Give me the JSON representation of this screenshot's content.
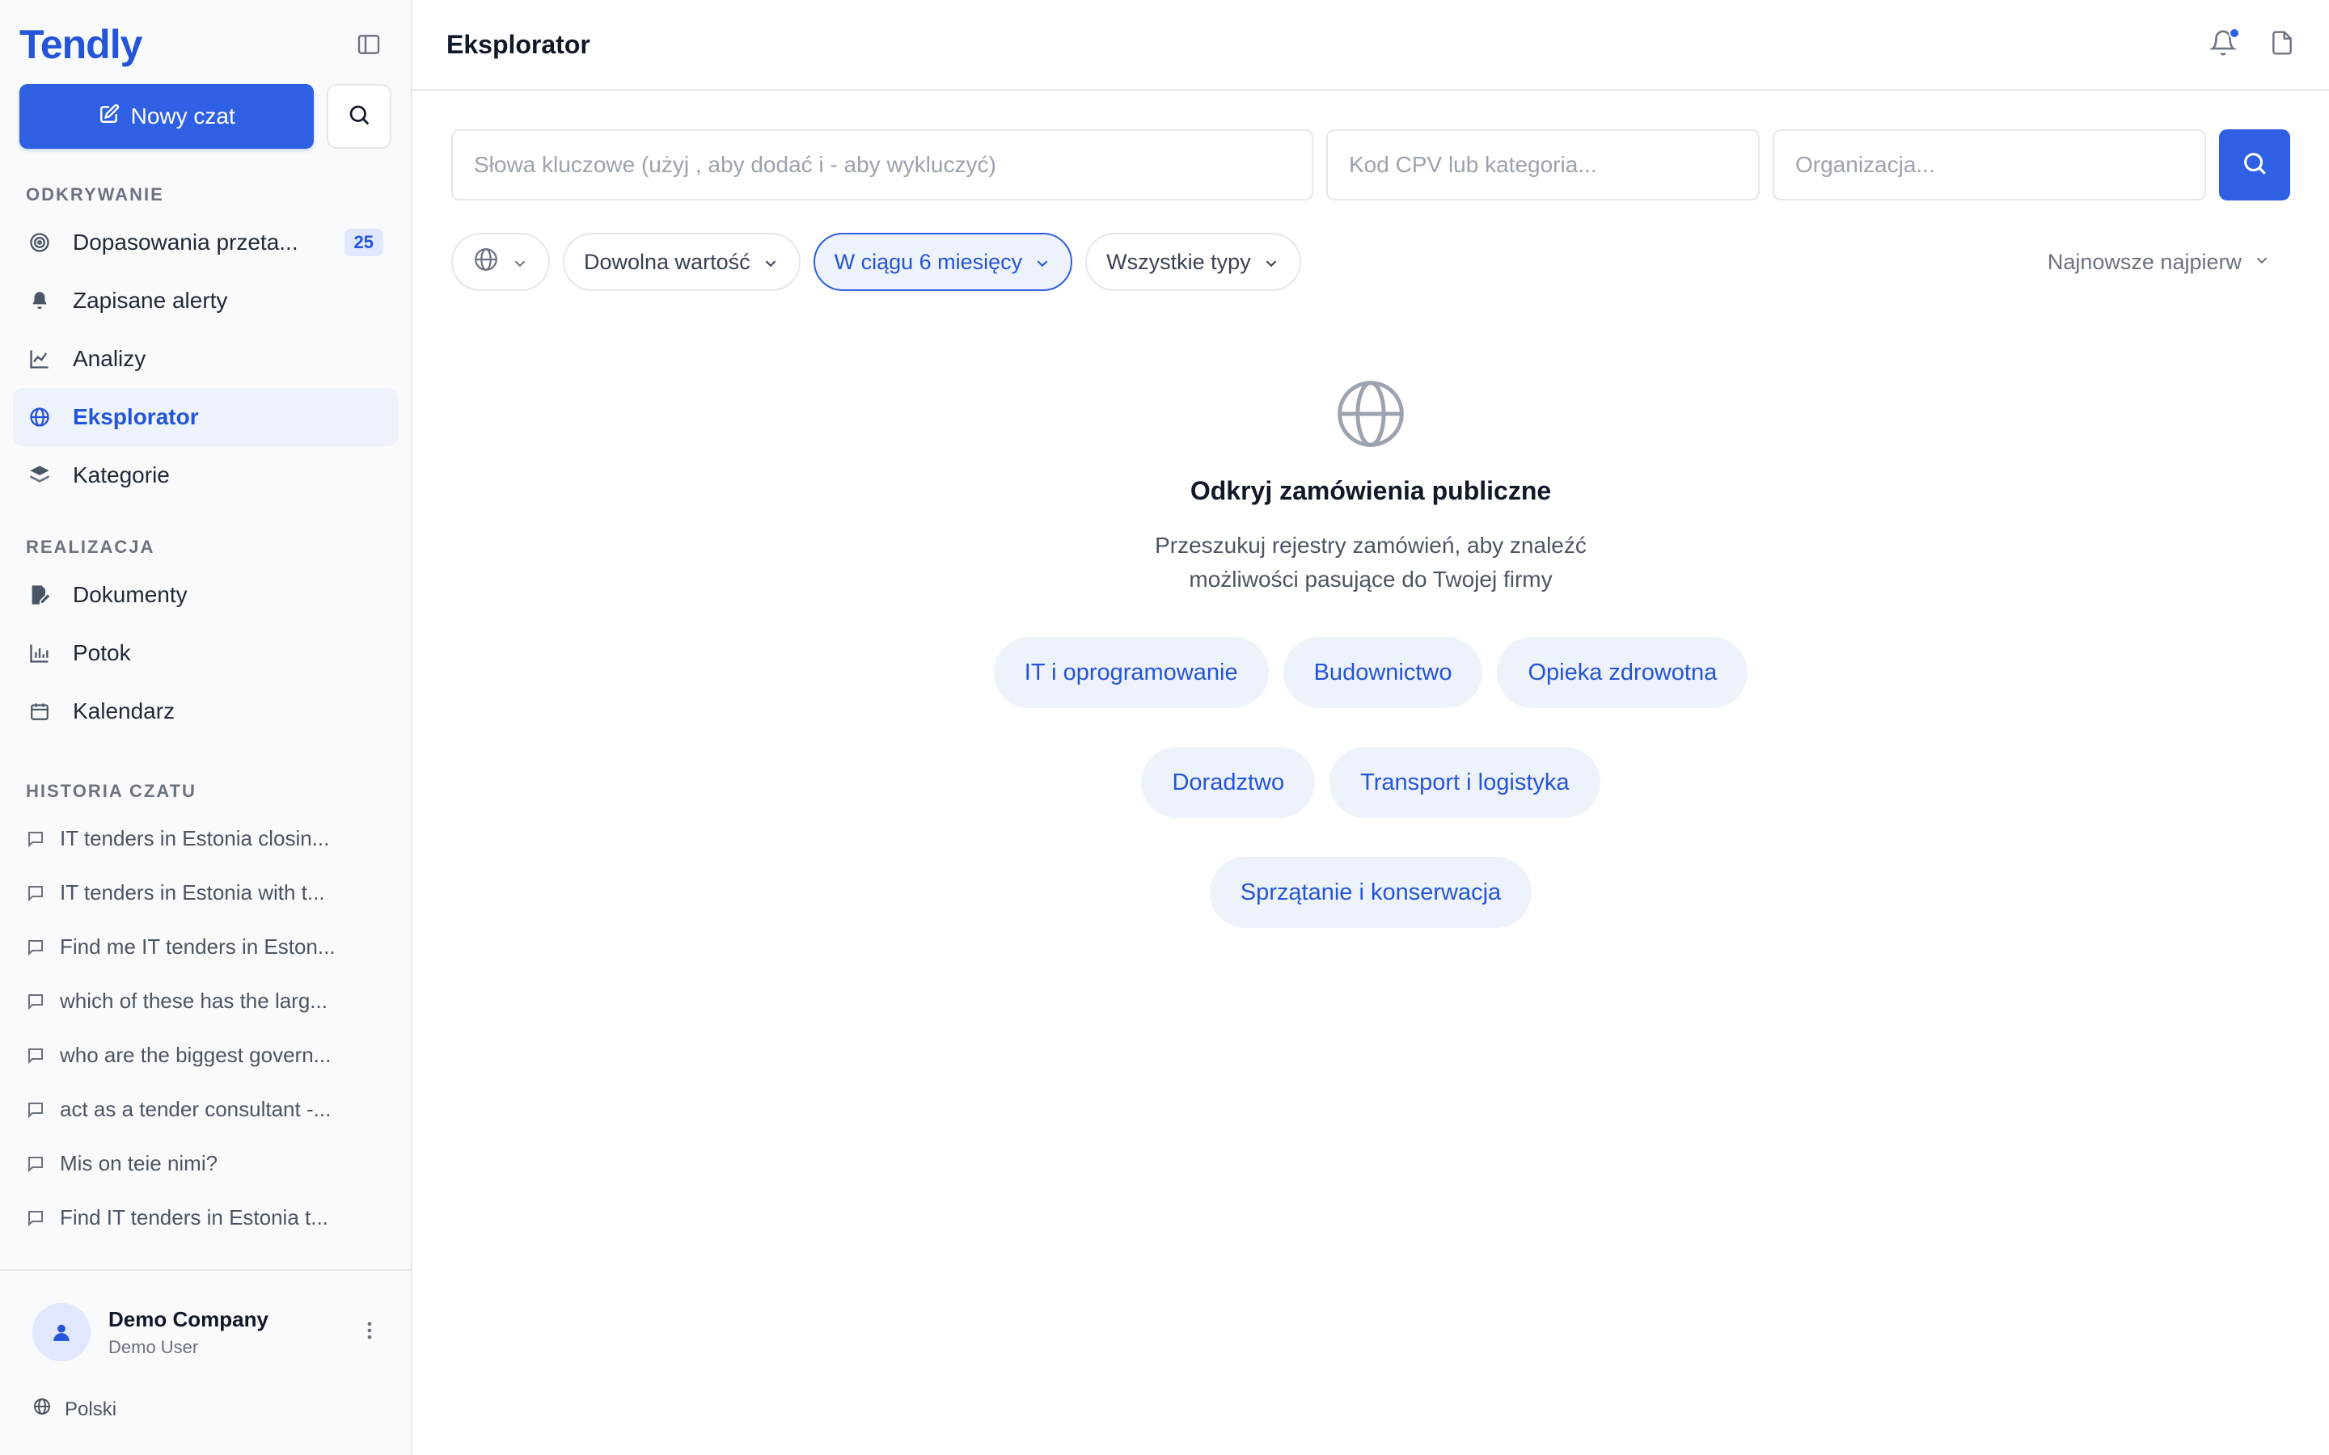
{
  "sidebar": {
    "brand": "Tendly",
    "new_chat_label": "Nowy czat",
    "sections": {
      "discovery": "ODKRYWANIE",
      "execution": "REALIZACJA",
      "history": "HISTORIA CZATU"
    },
    "discovery_items": [
      {
        "label": "Dopasowania przeta...",
        "icon": "target-icon",
        "badge": "25"
      },
      {
        "label": "Zapisane alerty",
        "icon": "bell-icon"
      },
      {
        "label": "Analizy",
        "icon": "chart-line-icon"
      },
      {
        "label": "Eksplorator",
        "icon": "globe-icon",
        "active": true
      },
      {
        "label": "Kategorie",
        "icon": "layers-icon"
      }
    ],
    "execution_items": [
      {
        "label": "Dokumenty",
        "icon": "document-edit-icon"
      },
      {
        "label": "Potok",
        "icon": "bar-chart-icon"
      },
      {
        "label": "Kalendarz",
        "icon": "calendar-icon"
      }
    ],
    "history_items": [
      "IT tenders in Estonia closin...",
      "IT tenders in Estonia with t...",
      "Find me IT tenders in Eston...",
      "which of these has the larg...",
      "who are the biggest govern...",
      "act as a tender consultant -...",
      "Mis on teie nimi?",
      "Find IT tenders in Estonia t..."
    ],
    "user": {
      "company": "Demo Company",
      "role": "Demo User"
    },
    "language": "Polski"
  },
  "header": {
    "title": "Eksplorator"
  },
  "search": {
    "keywords_placeholder": "Słowa kluczowe (użyj , aby dodać i - aby wykluczyć)",
    "cpv_placeholder": "Kod CPV lub kategoria...",
    "org_placeholder": "Organizacja..."
  },
  "filters": {
    "value": "Dowolna wartość",
    "period": "W ciągu 6 miesięcy",
    "types": "Wszystkie typy",
    "sort": "Najnowsze najpierw"
  },
  "empty_state": {
    "title": "Odkryj zamówienia publiczne",
    "description": "Przeszukuj rejestry zamówień, aby znaleźć możliwości pasujące do Twojej firmy",
    "chips": [
      [
        "IT i oprogramowanie",
        "Budownictwo",
        "Opieka zdrowotna"
      ],
      [
        "Doradztwo",
        "Transport i logistyka"
      ],
      [
        "Sprzątanie i konserwacja"
      ]
    ]
  },
  "colors": {
    "accent": "#2f5fe3",
    "brand": "#2454d8",
    "chip_bg": "#eef2fb"
  }
}
